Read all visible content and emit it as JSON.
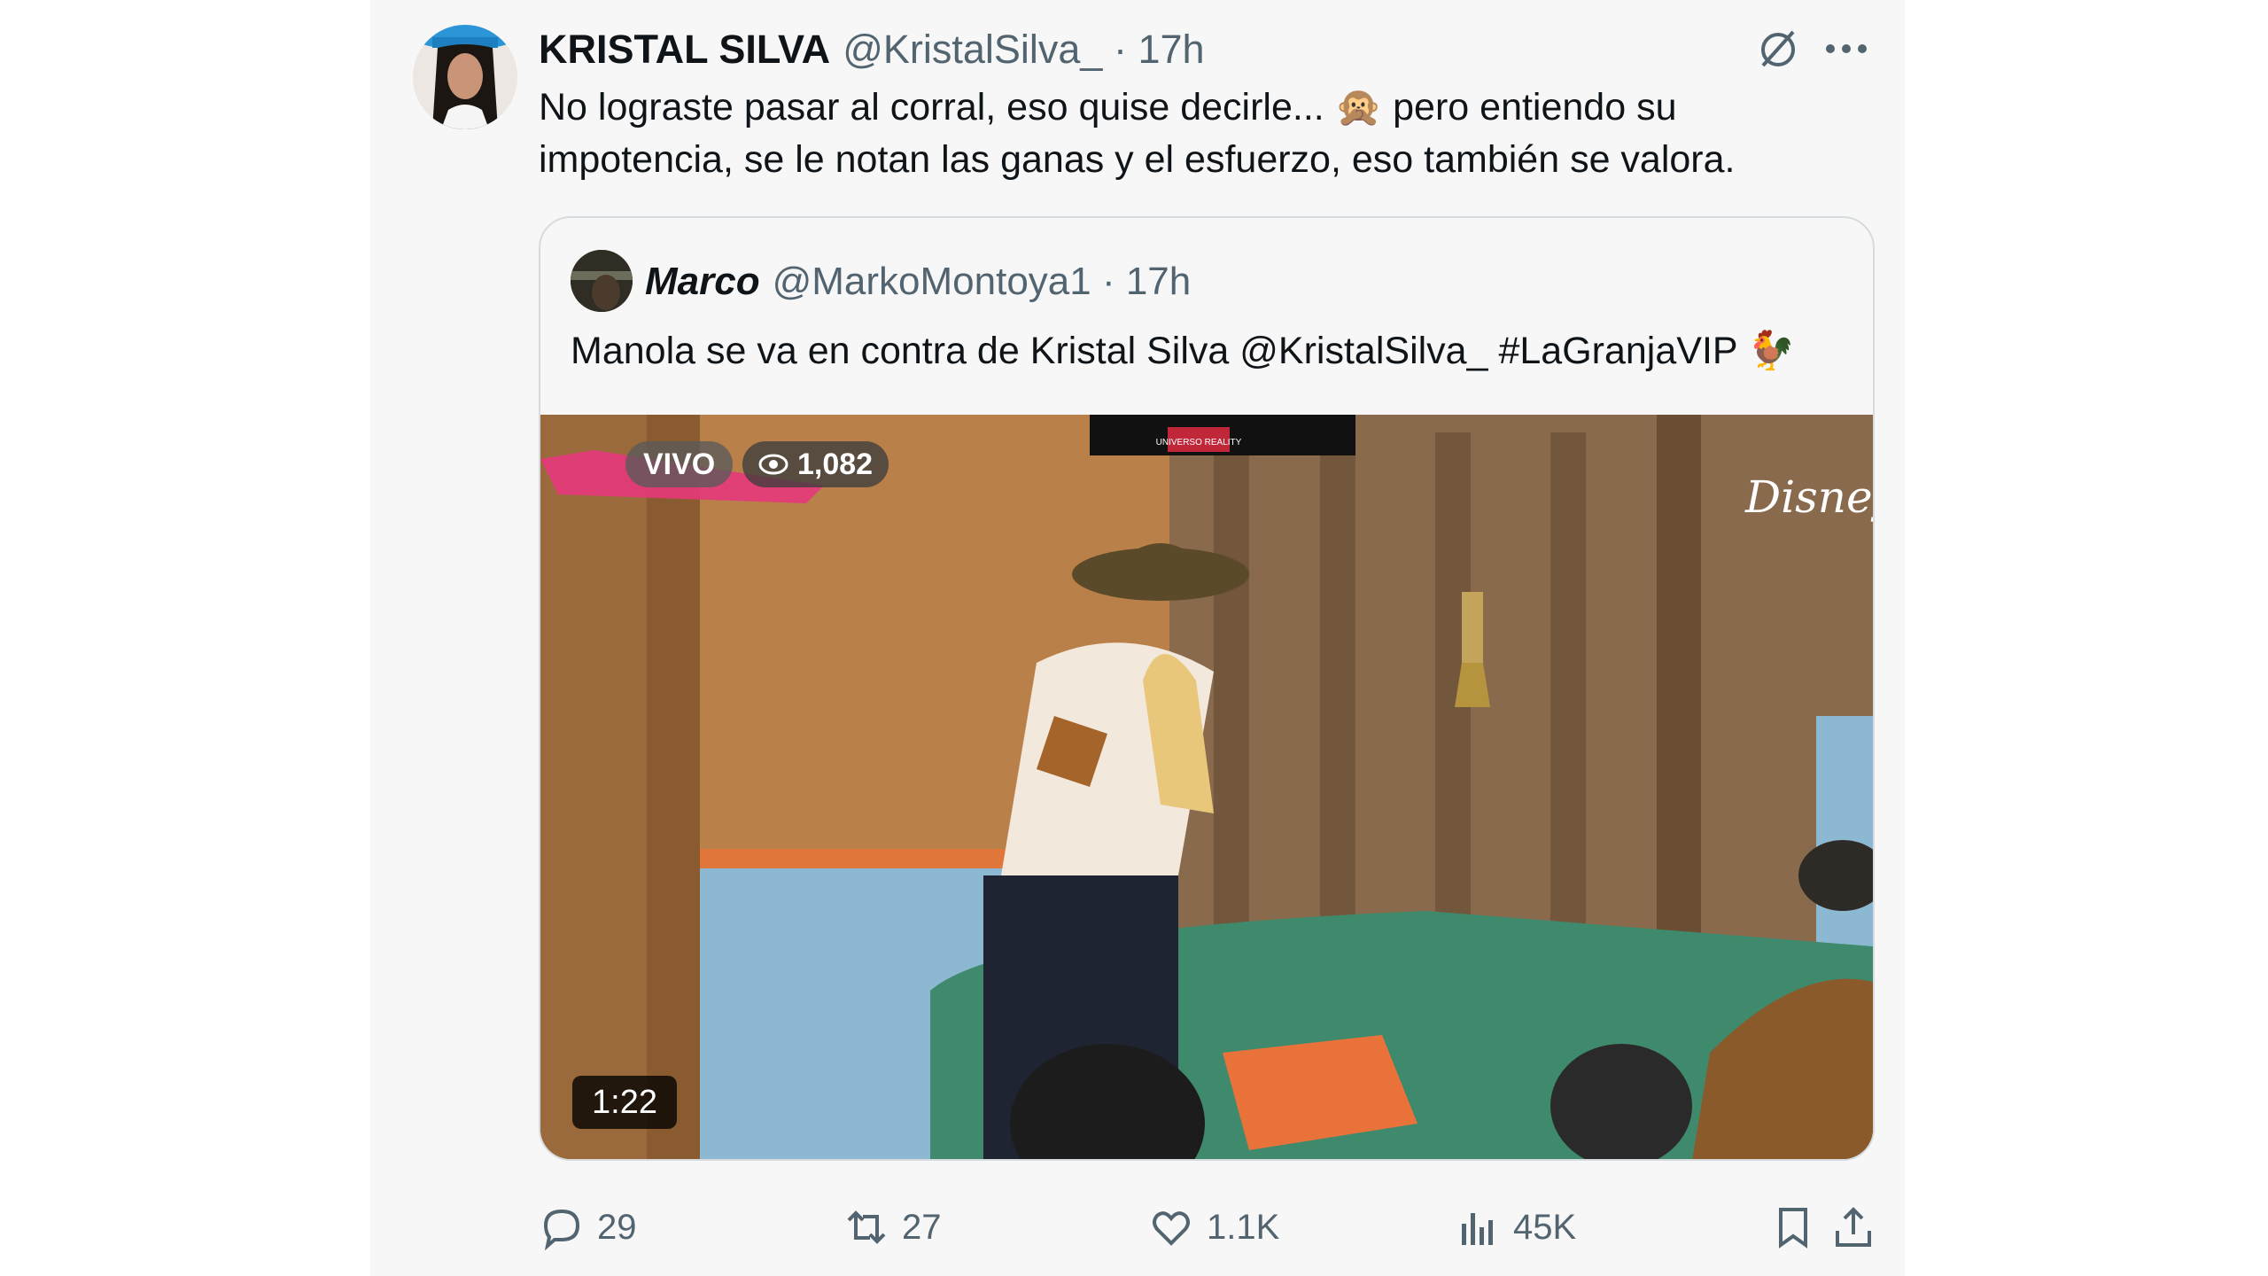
{
  "tweet": {
    "author_name": "KRISTAL SILVA",
    "meta": "@KristalSilva_ · 17h",
    "text_line1": "No lograste pasar al corral, eso quise decirle... 🙊 pero entiendo su",
    "text_line2": "impotencia, se le notan las ganas y el esfuerzo, eso también se valora."
  },
  "quote": {
    "author_name": "Marco",
    "meta": "@MarkoMontoya1 · 17h",
    "text": "Manola se va en contra de Kristal Silva @KristalSilva_ #LaGranjaVIP 🐓",
    "media": {
      "live_label": "VIVO",
      "views": "1,082",
      "duration": "1:22",
      "watermark": "Disney+",
      "banner": "UNIVERSO REALITY"
    }
  },
  "actions": {
    "replies": "29",
    "retweets": "27",
    "likes": "1.1K",
    "views": "45K"
  },
  "icons": [
    "grok-icon",
    "more-icon",
    "reply-icon",
    "retweet-icon",
    "like-icon",
    "views-icon",
    "bookmark-icon",
    "share-icon"
  ],
  "colors": {
    "text": "#0f1419",
    "secondary": "#536471",
    "border": "#d6dbdf"
  }
}
